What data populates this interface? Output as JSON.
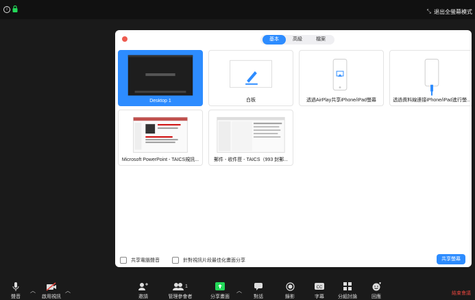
{
  "topbar": {
    "exit_fullscreen": "退出全螢幕模式"
  },
  "dialog": {
    "tabs": [
      {
        "label": "基本",
        "active": true
      },
      {
        "label": "高級",
        "active": false
      },
      {
        "label": "檔案",
        "active": false
      }
    ],
    "tiles": [
      {
        "label": "Desktop 1",
        "selected": true
      },
      {
        "label": "白板",
        "selected": false
      },
      {
        "label": "透過AirPlay共享iPhone/iPad螢幕",
        "selected": false
      },
      {
        "label": "透過資料線連接iPhone/iPad進行螢...",
        "selected": false
      },
      {
        "label": "Microsoft PowerPoint - TAICS規訊...",
        "selected": false
      },
      {
        "label": "郵件 - 收件匣 - TAICS（993 封郵...",
        "selected": false
      }
    ],
    "share_computer_sound": "共享電腦聲音",
    "optimize_video": "針對視訊片段最佳化畫面分享",
    "share_button": "共享螢幕"
  },
  "toolbar": {
    "audio": "聲音",
    "video": "啟用視訊",
    "invite": "邀請",
    "participants": "管理參會者",
    "participants_count": "1",
    "share": "分享畫面",
    "chat": "對話",
    "record": "錄影",
    "captions": "字幕",
    "breakout": "分組討論",
    "reactions": "回應",
    "end": "結束會議"
  },
  "colors": {
    "accent": "#2d8cff",
    "end": "#e5453d",
    "share_icon": "#23d959"
  }
}
